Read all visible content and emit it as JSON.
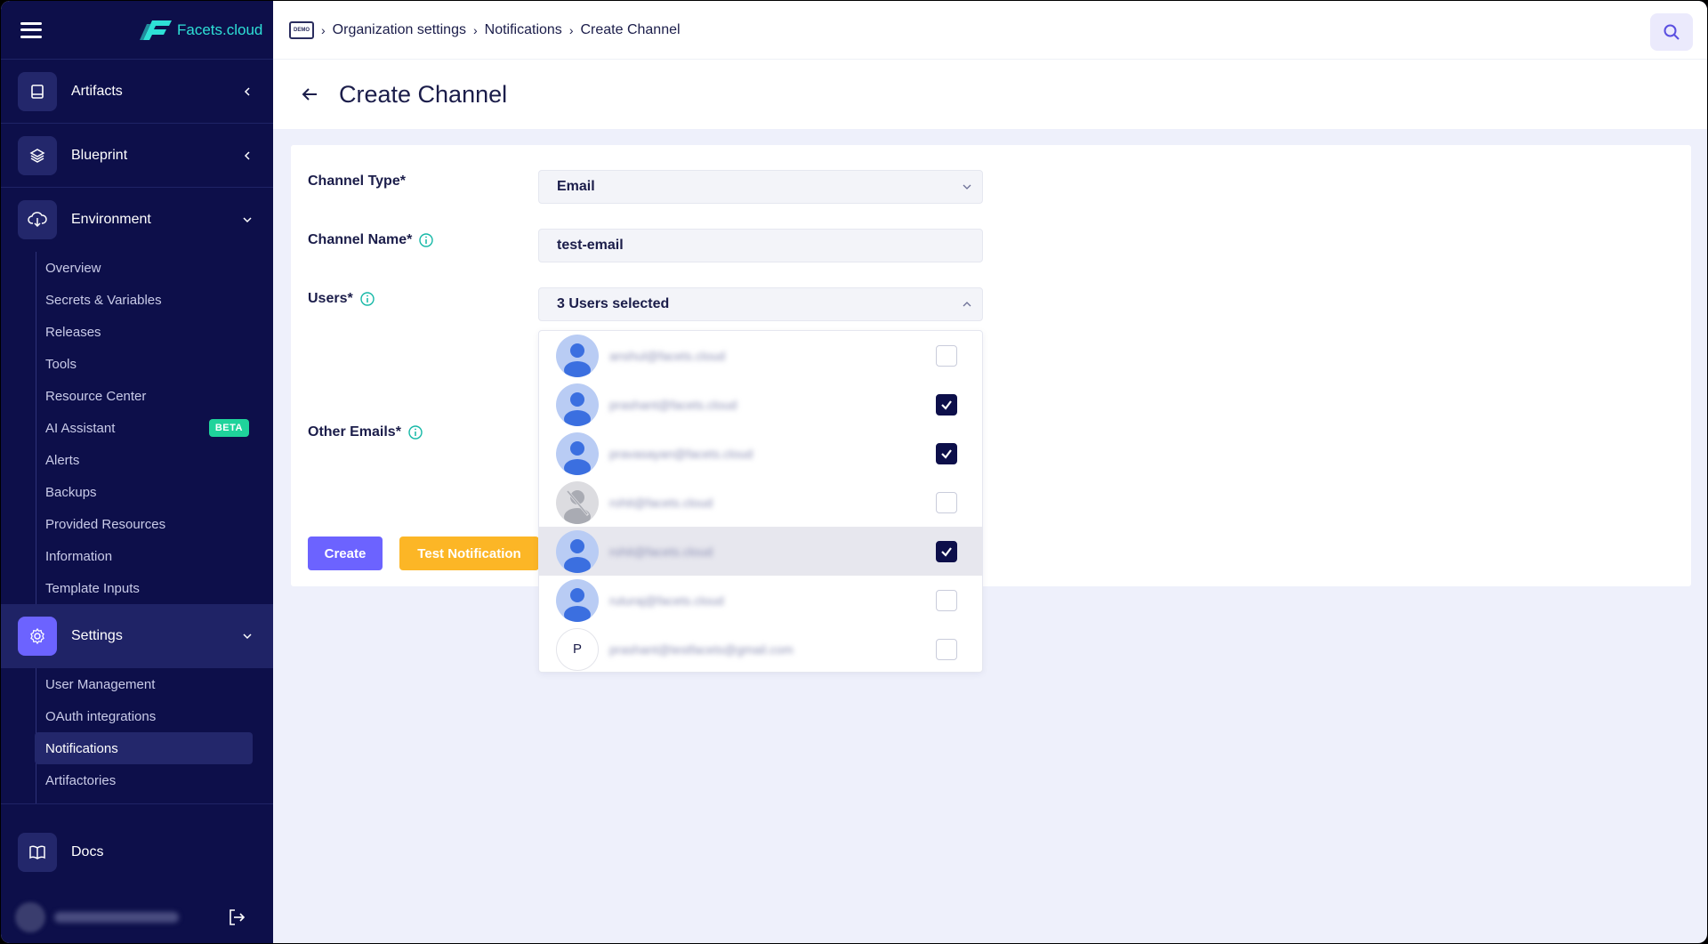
{
  "app": {
    "brand": "Facets.cloud",
    "badge": "DEMO"
  },
  "sidebar": {
    "groups": [
      {
        "label": "Artifacts",
        "icon": "book-icon",
        "state": "collapsed"
      },
      {
        "label": "Blueprint",
        "icon": "layers-icon",
        "state": "collapsed"
      },
      {
        "label": "Environment",
        "icon": "cloud-download-icon",
        "state": "expanded"
      }
    ],
    "environment_items": [
      "Overview",
      "Secrets & Variables",
      "Releases",
      "Tools",
      "Resource Center",
      "AI Assistant",
      "Alerts",
      "Backups",
      "Provided Resources",
      "Information",
      "Template Inputs"
    ],
    "beta_label": "BETA",
    "settings": {
      "label": "Settings",
      "icon": "gear-icon"
    },
    "settings_items": [
      "User Management",
      "OAuth integrations",
      "Notifications",
      "Artifactories"
    ],
    "active_item": "Notifications",
    "docs": {
      "label": "Docs",
      "icon": "open-book-icon"
    }
  },
  "breadcrumb": [
    "Organization settings",
    "Notifications",
    "Create Channel"
  ],
  "page": {
    "title": "Create Channel"
  },
  "form": {
    "channel_type": {
      "label": "Channel Type*",
      "value": "Email"
    },
    "channel_name": {
      "label": "Channel Name*",
      "value": "test-email"
    },
    "users": {
      "label": "Users*",
      "value": "3 Users selected"
    },
    "other_emails": {
      "label": "Other Emails*"
    },
    "create_label": "Create",
    "test_label": "Test Notification"
  },
  "users_dropdown": [
    {
      "avatar": "user",
      "email": "anshul@facets.cloud",
      "checked": false
    },
    {
      "avatar": "user",
      "email": "prashant@facets.cloud",
      "checked": true
    },
    {
      "avatar": "user",
      "email": "pravasayan@facets.cloud",
      "checked": true
    },
    {
      "avatar": "disabled-user",
      "email": "rohit@facets.cloud",
      "checked": false
    },
    {
      "avatar": "user",
      "email": "rohit@facets.cloud",
      "checked": true
    },
    {
      "avatar": "user",
      "email": "ruturaj@facets.cloud",
      "checked": false
    },
    {
      "avatar": "P",
      "email": "prashant@testfacets@gmail.com",
      "checked": false
    }
  ],
  "colors": {
    "sidebar_bg": "#0d0f4a",
    "primary": "#6c63ff",
    "warning": "#fcb626",
    "accent": "#2ee0d6",
    "beta": "#1fd39b"
  }
}
